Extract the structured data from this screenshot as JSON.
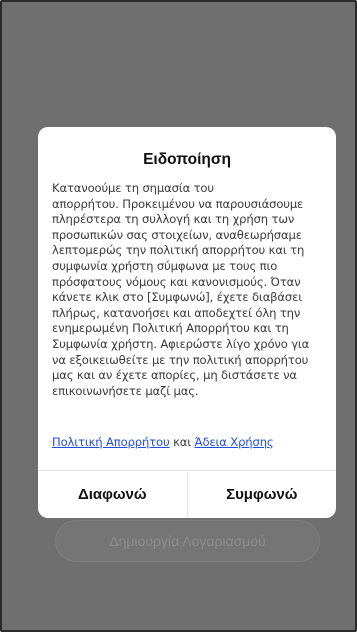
{
  "background": {
    "create_account_label": "Δημιουργία Λογαριασμού"
  },
  "dialog": {
    "title": "Ειδοποίηση",
    "body": "Κατανοούμε τη σημασία του\nαπορρήτου. Προκειμένου να παρουσιάσουμε\nπληρέστερα τη συλλογή και τη χρήση των\nπροσωπικών σας στοιχείων, αναθεωρήσαμε\nλεπτομερώς την πολιτική απορρήτου και τη\nσυμφωνία χρήστη σύμφωνα με τους πιο\nπρόσφατους νόμους και κανονισμούς. Όταν\nκάνετε κλικ στο [Συμφωνώ], έχετε διαβάσει\nπλήρως, κατανοήσει και αποδεχτεί όλη την\nενημερωμένη Πολιτική Απορρήτου και τη\nΣυμφωνία χρήστη. Αφιερώστε λίγο χρόνο για\nνα εξοικειωθείτε με την πολιτική απορρήτου\nμας και αν έχετε απορίες, μη διστάσετε να\nεπικοινωνήσετε μαζί μας.",
    "privacy_link": "Πολιτική Απορρήτου",
    "and_text": "και",
    "license_link": "Άδεια Χρήσης",
    "disagree_label": "Διαφωνώ",
    "agree_label": "Συμφωνώ"
  },
  "colors": {
    "overlay": "#6f6f6f",
    "dialog_bg": "#ffffff",
    "link": "#1f4fd6",
    "text": "#3a3a3a",
    "title": "#111111"
  }
}
